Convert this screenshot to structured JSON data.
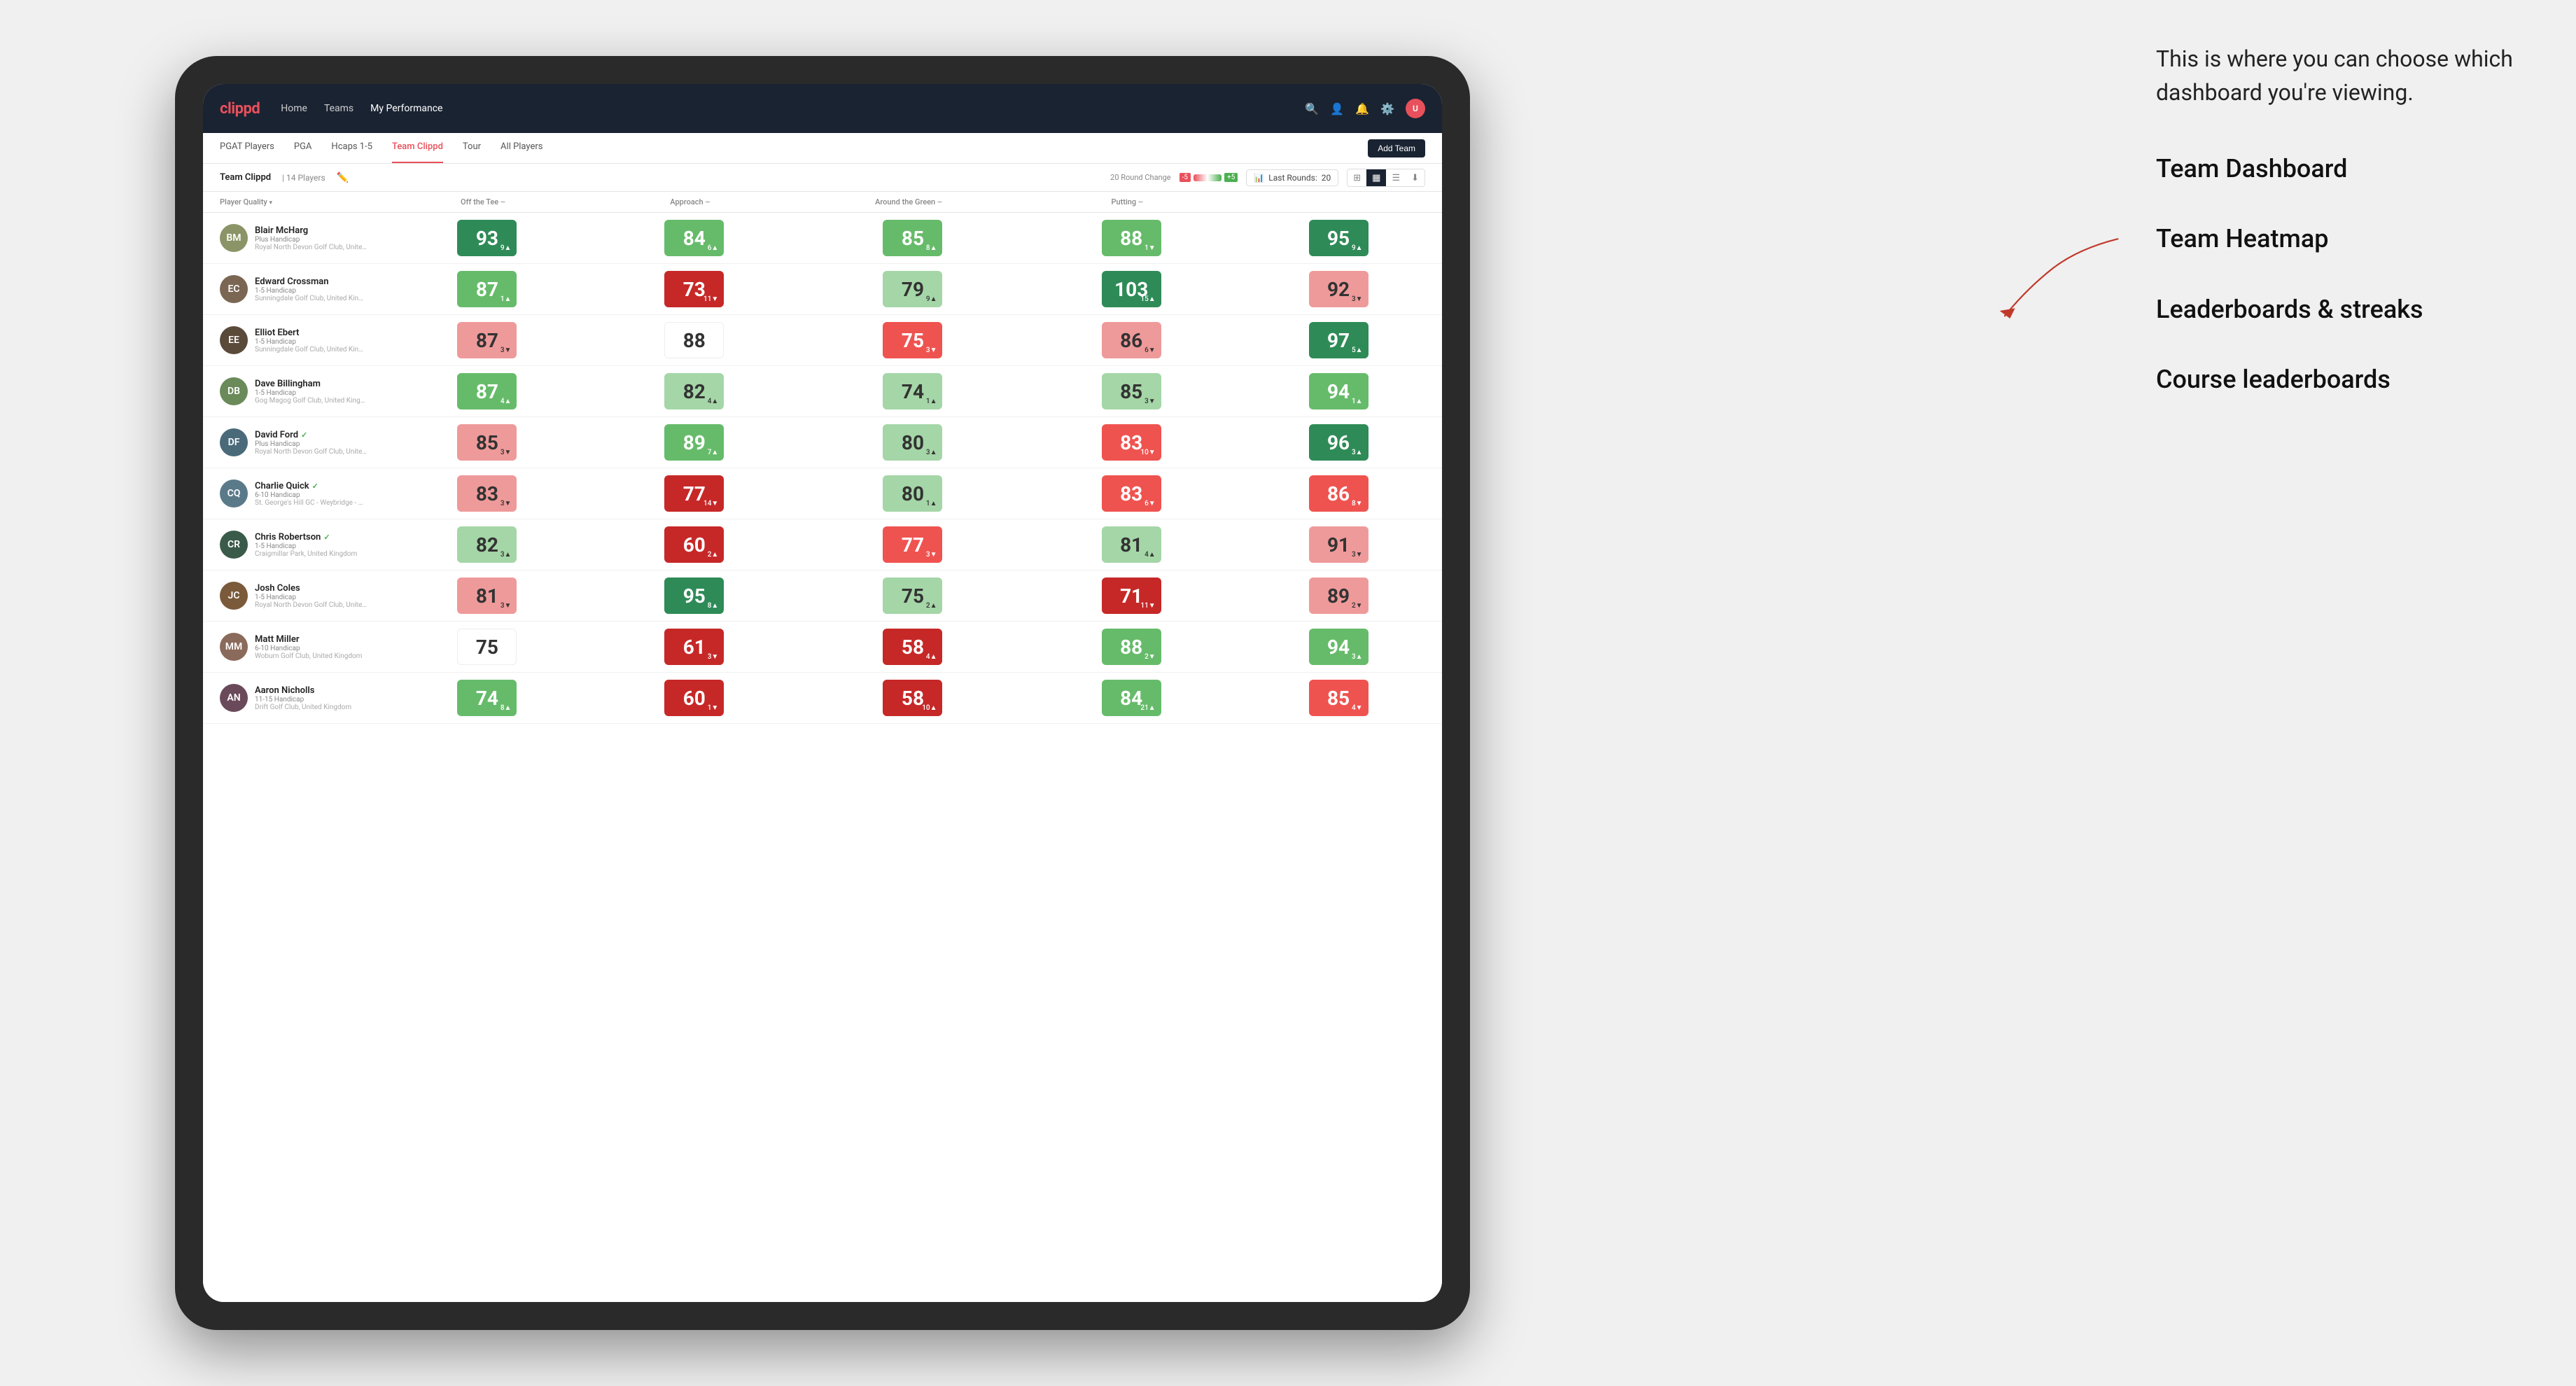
{
  "annotation": {
    "intro_text": "This is where you can choose which dashboard you're viewing.",
    "items": [
      "Team Dashboard",
      "Team Heatmap",
      "Leaderboards & streaks",
      "Course leaderboards"
    ]
  },
  "navbar": {
    "logo": "clippd",
    "links": [
      "Home",
      "Teams",
      "My Performance"
    ],
    "active_link": "My Performance"
  },
  "subnav": {
    "tabs": [
      "PGAT Players",
      "PGA",
      "Hcaps 1-5",
      "Team Clippd",
      "Tour",
      "All Players"
    ],
    "active_tab": "Team Clippd",
    "add_team_label": "Add Team"
  },
  "team_header": {
    "name": "Team Clippd",
    "separator": "|",
    "count_label": "14 Players",
    "round_change_label": "20 Round Change",
    "neg5": "-5",
    "pos5": "+5",
    "last_rounds_label": "Last Rounds:",
    "last_rounds_num": "20"
  },
  "table": {
    "column_headers": [
      {
        "id": "player",
        "label": "Player Quality",
        "has_arrow": true
      },
      {
        "id": "tee",
        "label": "Off the Tee",
        "has_arrow": true
      },
      {
        "id": "approach",
        "label": "Approach",
        "has_arrow": true
      },
      {
        "id": "around_green",
        "label": "Around the Green",
        "has_arrow": true
      },
      {
        "id": "putting",
        "label": "Putting",
        "has_arrow": true
      }
    ],
    "rows": [
      {
        "name": "Blair McHarg",
        "handicap": "Plus Handicap",
        "club": "Royal North Devon Golf Club, United Kingdom",
        "avatar_color": "#8B9467",
        "initials": "BM",
        "scores": [
          {
            "value": "93",
            "delta": "9▲",
            "bg": "bg-dark-green"
          },
          {
            "value": "84",
            "delta": "6▲",
            "bg": "bg-mid-green"
          },
          {
            "value": "85",
            "delta": "8▲",
            "bg": "bg-mid-green"
          },
          {
            "value": "88",
            "delta": "1▼",
            "bg": "bg-mid-green"
          },
          {
            "value": "95",
            "delta": "9▲",
            "bg": "bg-dark-green"
          }
        ]
      },
      {
        "name": "Edward Crossman",
        "handicap": "1-5 Handicap",
        "club": "Sunningdale Golf Club, United Kingdom",
        "avatar_color": "#7a6652",
        "initials": "EC",
        "scores": [
          {
            "value": "87",
            "delta": "1▲",
            "bg": "bg-mid-green"
          },
          {
            "value": "73",
            "delta": "11▼",
            "bg": "bg-dark-red"
          },
          {
            "value": "79",
            "delta": "9▲",
            "bg": "bg-light-green"
          },
          {
            "value": "103",
            "delta": "15▲",
            "bg": "bg-dark-green"
          },
          {
            "value": "92",
            "delta": "3▼",
            "bg": "bg-light-red"
          }
        ]
      },
      {
        "name": "Elliot Ebert",
        "handicap": "1-5 Handicap",
        "club": "Sunningdale Golf Club, United Kingdom",
        "avatar_color": "#5a4a3a",
        "initials": "EE",
        "scores": [
          {
            "value": "87",
            "delta": "3▼",
            "bg": "bg-light-red"
          },
          {
            "value": "88",
            "delta": "",
            "bg": "bg-white"
          },
          {
            "value": "75",
            "delta": "3▼",
            "bg": "bg-mid-red"
          },
          {
            "value": "86",
            "delta": "6▼",
            "bg": "bg-light-red"
          },
          {
            "value": "97",
            "delta": "5▲",
            "bg": "bg-dark-green"
          }
        ]
      },
      {
        "name": "Dave Billingham",
        "handicap": "1-5 Handicap",
        "club": "Gog Magog Golf Club, United Kingdom",
        "avatar_color": "#6a8a5a",
        "initials": "DB",
        "scores": [
          {
            "value": "87",
            "delta": "4▲",
            "bg": "bg-mid-green"
          },
          {
            "value": "82",
            "delta": "4▲",
            "bg": "bg-light-green"
          },
          {
            "value": "74",
            "delta": "1▲",
            "bg": "bg-light-green"
          },
          {
            "value": "85",
            "delta": "3▼",
            "bg": "bg-light-green"
          },
          {
            "value": "94",
            "delta": "1▲",
            "bg": "bg-mid-green"
          }
        ]
      },
      {
        "name": "David Ford",
        "handicap": "Plus Handicap",
        "club": "Royal North Devon Golf Club, United Kingdom",
        "avatar_color": "#4a6a7a",
        "initials": "DF",
        "verified": true,
        "scores": [
          {
            "value": "85",
            "delta": "3▼",
            "bg": "bg-light-red"
          },
          {
            "value": "89",
            "delta": "7▲",
            "bg": "bg-mid-green"
          },
          {
            "value": "80",
            "delta": "3▲",
            "bg": "bg-light-green"
          },
          {
            "value": "83",
            "delta": "10▼",
            "bg": "bg-mid-red"
          },
          {
            "value": "96",
            "delta": "3▲",
            "bg": "bg-dark-green"
          }
        ]
      },
      {
        "name": "Charlie Quick",
        "handicap": "6-10 Handicap",
        "club": "St. George's Hill GC - Weybridge - Surrey, Uni...",
        "avatar_color": "#5a7a8a",
        "initials": "CQ",
        "verified": true,
        "scores": [
          {
            "value": "83",
            "delta": "3▼",
            "bg": "bg-light-red"
          },
          {
            "value": "77",
            "delta": "14▼",
            "bg": "bg-dark-red"
          },
          {
            "value": "80",
            "delta": "1▲",
            "bg": "bg-light-green"
          },
          {
            "value": "83",
            "delta": "6▼",
            "bg": "bg-mid-red"
          },
          {
            "value": "86",
            "delta": "8▼",
            "bg": "bg-mid-red"
          }
        ]
      },
      {
        "name": "Chris Robertson",
        "handicap": "1-5 Handicap",
        "club": "Craigmillar Park, United Kingdom",
        "avatar_color": "#3a5a4a",
        "initials": "CR",
        "verified": true,
        "scores": [
          {
            "value": "82",
            "delta": "3▲",
            "bg": "bg-light-green"
          },
          {
            "value": "60",
            "delta": "2▲",
            "bg": "bg-dark-red"
          },
          {
            "value": "77",
            "delta": "3▼",
            "bg": "bg-mid-red"
          },
          {
            "value": "81",
            "delta": "4▲",
            "bg": "bg-light-green"
          },
          {
            "value": "91",
            "delta": "3▼",
            "bg": "bg-light-red"
          }
        ]
      },
      {
        "name": "Josh Coles",
        "handicap": "1-5 Handicap",
        "club": "Royal North Devon Golf Club, United Kingdom",
        "avatar_color": "#7a5a3a",
        "initials": "JC",
        "scores": [
          {
            "value": "81",
            "delta": "3▼",
            "bg": "bg-light-red"
          },
          {
            "value": "95",
            "delta": "8▲",
            "bg": "bg-dark-green"
          },
          {
            "value": "75",
            "delta": "2▲",
            "bg": "bg-light-green"
          },
          {
            "value": "71",
            "delta": "11▼",
            "bg": "bg-dark-red"
          },
          {
            "value": "89",
            "delta": "2▼",
            "bg": "bg-light-red"
          }
        ]
      },
      {
        "name": "Matt Miller",
        "handicap": "6-10 Handicap",
        "club": "Woburn Golf Club, United Kingdom",
        "avatar_color": "#8a6a5a",
        "initials": "MM",
        "scores": [
          {
            "value": "75",
            "delta": "",
            "bg": "bg-white"
          },
          {
            "value": "61",
            "delta": "3▼",
            "bg": "bg-dark-red"
          },
          {
            "value": "58",
            "delta": "4▲",
            "bg": "bg-dark-red"
          },
          {
            "value": "88",
            "delta": "2▼",
            "bg": "bg-mid-green"
          },
          {
            "value": "94",
            "delta": "3▲",
            "bg": "bg-mid-green"
          }
        ]
      },
      {
        "name": "Aaron Nicholls",
        "handicap": "11-15 Handicap",
        "club": "Drift Golf Club, United Kingdom",
        "avatar_color": "#6a4a5a",
        "initials": "AN",
        "scores": [
          {
            "value": "74",
            "delta": "8▲",
            "bg": "bg-mid-green"
          },
          {
            "value": "60",
            "delta": "1▼",
            "bg": "bg-dark-red"
          },
          {
            "value": "58",
            "delta": "10▲",
            "bg": "bg-dark-red"
          },
          {
            "value": "84",
            "delta": "21▲",
            "bg": "bg-mid-green"
          },
          {
            "value": "85",
            "delta": "4▼",
            "bg": "bg-mid-red"
          }
        ]
      }
    ]
  }
}
